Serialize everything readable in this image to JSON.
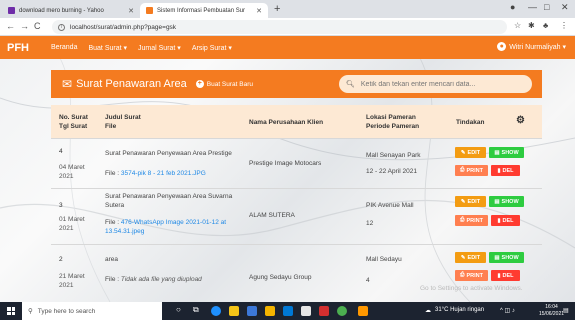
{
  "browser": {
    "tabs": [
      {
        "label": "download mero burning - Yahoo",
        "favicon_color": "#6f2da8"
      },
      {
        "label": "Sistem Informasi Pembuatan Sur",
        "favicon_color": "#f47b20"
      }
    ],
    "url": "localhost/surat/admin.php?page=gsk"
  },
  "nav": {
    "brand": "PFH",
    "items": [
      "Beranda",
      "Buat Surat ▾",
      "Jumal Surat ▾",
      "Arsip Surat ▾"
    ],
    "user": "Witri Nurmaliyah ▾"
  },
  "header": {
    "title": "Surat Penawaran Area",
    "new_button": "Buat Surat Baru",
    "search_placeholder": "Ketik dan tekan enter mencari data..."
  },
  "table": {
    "headers": {
      "no_line1": "No. Surat",
      "no_line2": "Tgl Surat",
      "judul_line1": "Judul Surat",
      "judul_line2": "File",
      "perusahaan": "Nama Perusahaan Klien",
      "lokasi_line1": "Lokasi Pameran",
      "lokasi_line2": "Periode Pameran",
      "tindakan": "Tindakan"
    },
    "rows": [
      {
        "no": "4",
        "date_line1": "04 Maret",
        "date_line2": "2021",
        "judul": "Surat Penawaran Penyewaan Area Prestige",
        "judul_line2": "",
        "file_label": "File :",
        "file_name": "3574-pik 8 - 21 feb 2021.JPG",
        "file_name2": "",
        "file_note": "",
        "company": "Prestige Image Motocars",
        "lokasi": "Mall Senayan Park",
        "periode": "12 - 22 April 2021"
      },
      {
        "no": "3",
        "date_line1": "01 Maret",
        "date_line2": "2021",
        "judul": "Surat Penawaran Penyewaan Area Suvarna",
        "judul_line2": "Sutera",
        "file_label": "File :",
        "file_name": "476-WhatsApp Image 2021-01-12 at",
        "file_name2": "13.54.31.jpeg",
        "file_note": "",
        "company": "ALAM SUTERA",
        "lokasi": "PIK Avenue Mall",
        "periode": "12"
      },
      {
        "no": "2",
        "date_line1": "21 Maret",
        "date_line2": "2021",
        "judul": "area",
        "judul_line2": "",
        "file_label": "File :",
        "file_name": "",
        "file_name2": "",
        "file_note": "Tidak ada file yang diupload",
        "company": "Agung Sedayu Group",
        "lokasi": "Mall Sedayu",
        "periode": "4"
      }
    ],
    "buttons": {
      "edit": "EDIT",
      "show": "SHOW",
      "print": "PRINT",
      "del": "DEL"
    }
  },
  "watermark": "Go to Settings to activate Windows.",
  "taskbar": {
    "search_placeholder": "Type here to search",
    "weather": "31°C  Hujan ringan",
    "time": "16:04",
    "date": "15/06/2021"
  },
  "colors": {
    "accent": "#f47b20",
    "edit": "#f39c12",
    "show": "#2ecc40",
    "print": "#ff7f50",
    "del": "#ff3b30"
  }
}
